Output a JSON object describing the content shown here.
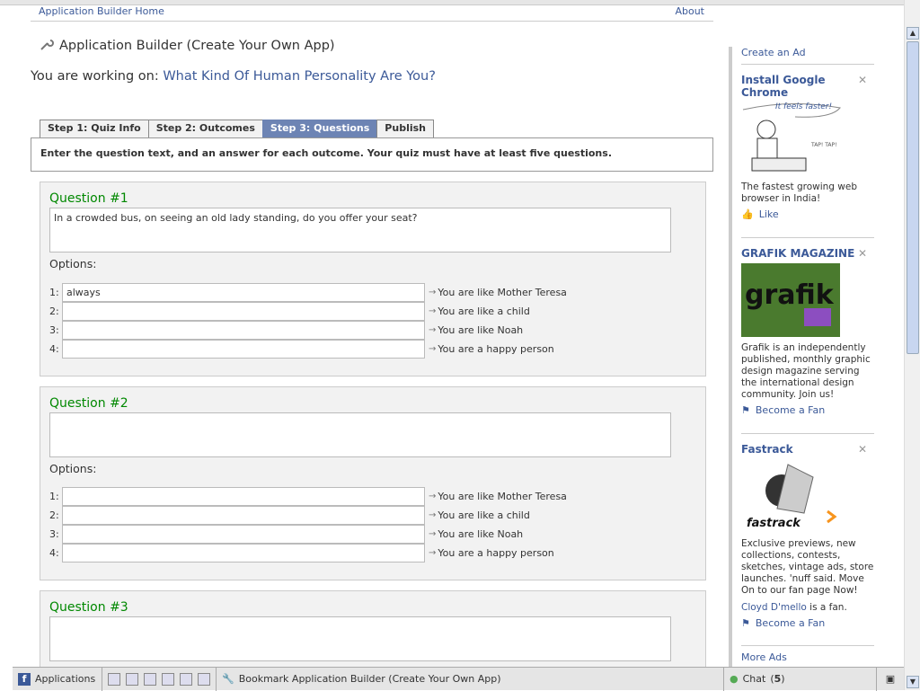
{
  "nav": {
    "home": "Application Builder Home",
    "about": "About"
  },
  "app_title": "Application Builder (Create Your Own App)",
  "working_label": "You are working on:",
  "working_value": "What Kind Of Human Personality Are You?",
  "tabs": [
    {
      "label": "Step 1: Quiz Info"
    },
    {
      "label": "Step 2: Outcomes"
    },
    {
      "label": "Step 3: Questions"
    },
    {
      "label": "Publish"
    }
  ],
  "instructions": "Enter the question text, and an answer for each outcome. Your quiz must have at least five questions.",
  "options_label": "Options:",
  "outcomes": [
    "You are like Mother Teresa",
    "You are like a child",
    "You are like Noah",
    "You are a happy person"
  ],
  "questions": [
    {
      "title": "Question #1",
      "text": "In a crowded bus, on seeing an old lady standing, do you offer your seat?",
      "answers": [
        "always",
        "",
        "",
        ""
      ]
    },
    {
      "title": "Question #2",
      "text": "",
      "answers": [
        "",
        "",
        "",
        ""
      ]
    },
    {
      "title": "Question #3",
      "text": ""
    }
  ],
  "nums": [
    "1:",
    "2:",
    "3:",
    "4:"
  ],
  "ads": {
    "create": "Create an Ad",
    "items": [
      {
        "title": "Install Google Chrome",
        "image_caption": "It feels faster!",
        "image_note": "TAP! TAP!",
        "desc": "The fastest growing web browser in India!",
        "action": "Like"
      },
      {
        "title": "GRAFIK MAGAZINE",
        "image_caption": "grafik",
        "desc": "Grafik is an independently published, monthly graphic design magazine serving the international design community. Join us!",
        "action": "Become a Fan"
      },
      {
        "title": "Fastrack",
        "image_caption": "fastrack",
        "desc": "Exclusive previews, new collections, contests, sketches, vintage ads, store launches. 'nuff said. Move On to our fan page Now!",
        "fan_name": "Cloyd D'mello",
        "fan_suffix": "is a fan.",
        "action": "Become a Fan"
      }
    ],
    "more": "More Ads"
  },
  "bottombar": {
    "applications": "Applications",
    "bookmark": "Bookmark Application Builder (Create Your Own App)",
    "chat": "Chat",
    "chat_count": "5"
  },
  "colors": {
    "link": "#3b5998",
    "question_title": "#008800",
    "active_tab": "#6d84b4"
  }
}
